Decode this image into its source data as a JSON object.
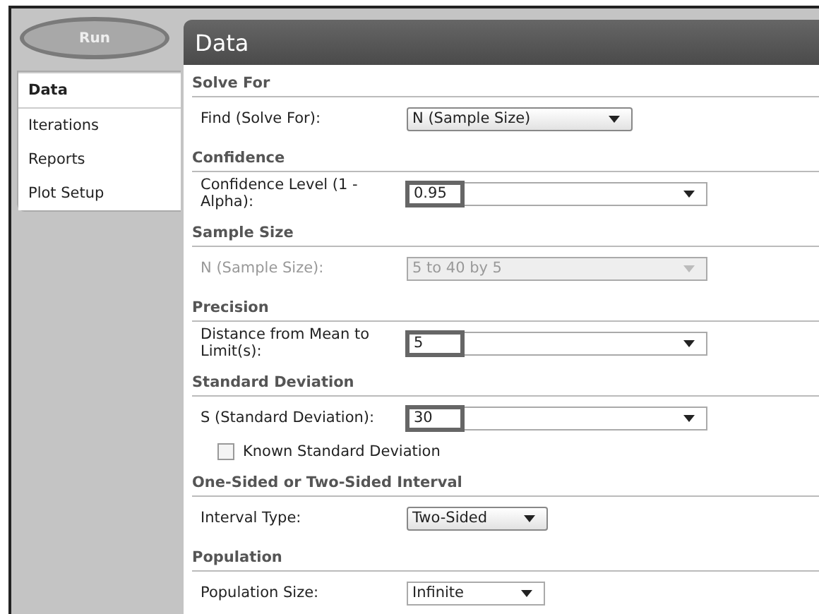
{
  "run_button": {
    "label": "Run"
  },
  "tabs": [
    {
      "label": "Data",
      "selected": true
    },
    {
      "label": "Iterations",
      "selected": false
    },
    {
      "label": "Reports",
      "selected": false
    },
    {
      "label": "Plot Setup",
      "selected": false
    }
  ],
  "panel": {
    "title": "Data"
  },
  "sections": [
    {
      "heading": "Solve For",
      "rows": [
        {
          "kind": "dropdown",
          "label": "Find (Solve For):",
          "value": "N (Sample Size)",
          "disabled": false,
          "highlighted": false
        }
      ]
    },
    {
      "heading": "Confidence",
      "rows": [
        {
          "kind": "combo",
          "label": "Confidence Level (1 - Alpha):",
          "value": "0.95",
          "disabled": false,
          "highlighted": true
        }
      ]
    },
    {
      "heading": "Sample Size",
      "rows": [
        {
          "kind": "combo",
          "label": "N (Sample Size):",
          "value": "5 to 40 by 5",
          "disabled": true,
          "highlighted": false
        }
      ]
    },
    {
      "heading": "Precision",
      "rows": [
        {
          "kind": "combo",
          "label": "Distance from Mean to Limit(s):",
          "value": "5",
          "disabled": false,
          "highlighted": true
        }
      ]
    },
    {
      "heading": "Standard Deviation",
      "rows": [
        {
          "kind": "combo",
          "label": "S (Standard Deviation):",
          "value": "30",
          "disabled": false,
          "highlighted": true
        },
        {
          "kind": "checkbox",
          "label": "Known Standard Deviation",
          "checked": false
        }
      ]
    },
    {
      "heading": "One-Sided or Two-Sided Interval",
      "rows": [
        {
          "kind": "small-dropdown",
          "label": "Interval Type:",
          "value": "Two-Sided",
          "disabled": false,
          "highlighted": false
        }
      ]
    },
    {
      "heading": "Population",
      "rows": [
        {
          "kind": "small-combo",
          "label": "Population Size:",
          "value": "Infinite",
          "disabled": false,
          "highlighted": false
        }
      ]
    }
  ]
}
